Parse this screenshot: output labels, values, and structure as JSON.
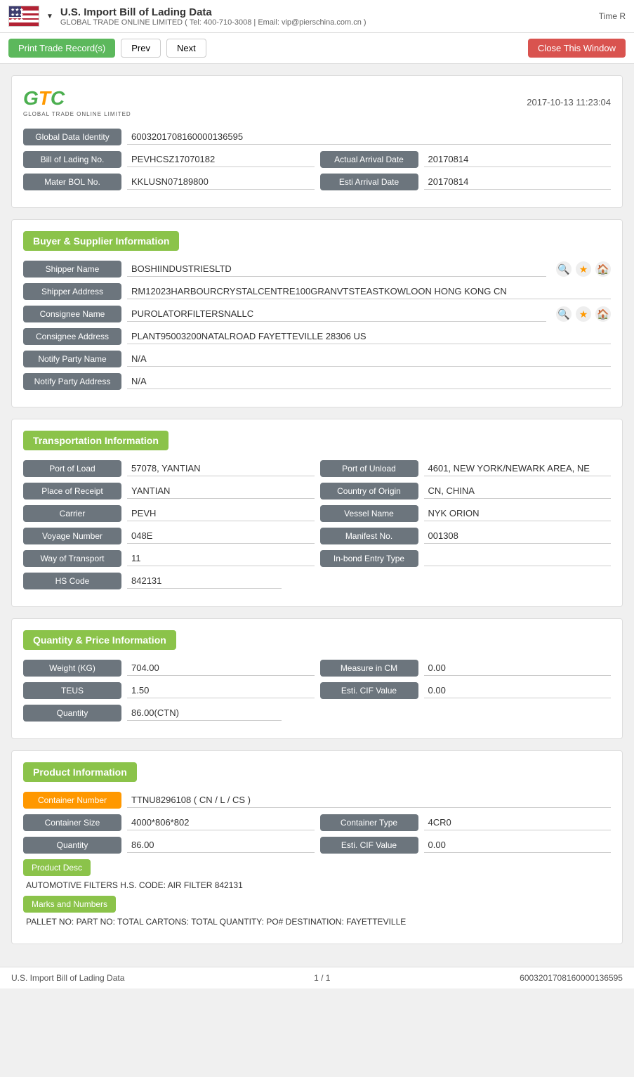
{
  "header": {
    "title": "U.S. Import Bill of Lading Data",
    "subtitle": "GLOBAL TRADE ONLINE LIMITED ( Tel: 400-710-3008 | Email: vip@pierschina.com.cn )",
    "time_label": "Time R"
  },
  "toolbar": {
    "print_label": "Print Trade Record(s)",
    "prev_label": "Prev",
    "next_label": "Next",
    "close_label": "Close This Window"
  },
  "logo": {
    "datetime": "2017-10-13 11:23:04",
    "sub": "GLOBAL TRADE ONLINE LIMITED"
  },
  "basic": {
    "global_data_identity_label": "Global Data Identity",
    "global_data_identity_value": "6003201708160000136595",
    "bill_of_lading_label": "Bill of Lading No.",
    "bill_of_lading_value": "PEVHCSZ17070182",
    "actual_arrival_date_label": "Actual Arrival Date",
    "actual_arrival_date_value": "20170814",
    "mater_bol_label": "Mater BOL No.",
    "mater_bol_value": "KKLUSN07189800",
    "esti_arrival_date_label": "Esti Arrival Date",
    "esti_arrival_date_value": "20170814"
  },
  "buyer_supplier": {
    "section_label": "Buyer & Supplier Information",
    "shipper_name_label": "Shipper Name",
    "shipper_name_value": "BOSHIINDUSTRIESLTD",
    "shipper_address_label": "Shipper Address",
    "shipper_address_value": "RM12023HARBOURCRYSTALCENTRE100GRANVTSTEASTKOWLOON HONG KONG CN",
    "consignee_name_label": "Consignee Name",
    "consignee_name_value": "PUROLATORFILTERSNALLC",
    "consignee_address_label": "Consignee Address",
    "consignee_address_value": "PLANT95003200NATALROAD FAYETTEVILLE 28306 US",
    "notify_party_name_label": "Notify Party Name",
    "notify_party_name_value": "N/A",
    "notify_party_address_label": "Notify Party Address",
    "notify_party_address_value": "N/A"
  },
  "transportation": {
    "section_label": "Transportation Information",
    "port_of_load_label": "Port of Load",
    "port_of_load_value": "57078, YANTIAN",
    "port_of_unload_label": "Port of Unload",
    "port_of_unload_value": "4601, NEW YORK/NEWARK AREA, NE",
    "place_of_receipt_label": "Place of Receipt",
    "place_of_receipt_value": "YANTIAN",
    "country_of_origin_label": "Country of Origin",
    "country_of_origin_value": "CN, CHINA",
    "carrier_label": "Carrier",
    "carrier_value": "PEVH",
    "vessel_name_label": "Vessel Name",
    "vessel_name_value": "NYK ORION",
    "voyage_number_label": "Voyage Number",
    "voyage_number_value": "048E",
    "manifest_no_label": "Manifest No.",
    "manifest_no_value": "001308",
    "way_of_transport_label": "Way of Transport",
    "way_of_transport_value": "11",
    "inbond_entry_type_label": "In-bond Entry Type",
    "inbond_entry_type_value": "",
    "hs_code_label": "HS Code",
    "hs_code_value": "842131"
  },
  "quantity_price": {
    "section_label": "Quantity & Price Information",
    "weight_label": "Weight (KG)",
    "weight_value": "704.00",
    "measure_in_cm_label": "Measure in CM",
    "measure_in_cm_value": "0.00",
    "teus_label": "TEUS",
    "teus_value": "1.50",
    "esti_cif_value_label": "Esti. CIF Value",
    "esti_cif_value_value": "0.00",
    "quantity_label": "Quantity",
    "quantity_value": "86.00(CTN)"
  },
  "product_information": {
    "section_label": "Product Information",
    "container_number_label": "Container Number",
    "container_number_value": "TTNU8296108 ( CN / L / CS )",
    "container_size_label": "Container Size",
    "container_size_value": "4000*806*802",
    "container_type_label": "Container Type",
    "container_type_value": "4CR0",
    "quantity_label": "Quantity",
    "quantity_value": "86.00",
    "esti_cif_value_label": "Esti. CIF Value",
    "esti_cif_value_value": "0.00",
    "product_desc_label": "Product Desc",
    "product_desc_text": "AUTOMOTIVE FILTERS H.S. CODE: AIR FILTER 842131",
    "marks_and_numbers_label": "Marks and Numbers",
    "marks_and_numbers_text": "PALLET NO: PART NO: TOTAL CARTONS: TOTAL QUANTITY: PO# DESTINATION: FAYETTEVILLE"
  },
  "footer": {
    "left": "U.S. Import Bill of Lading Data",
    "center": "1 / 1",
    "right": "6003201708160000136595"
  }
}
